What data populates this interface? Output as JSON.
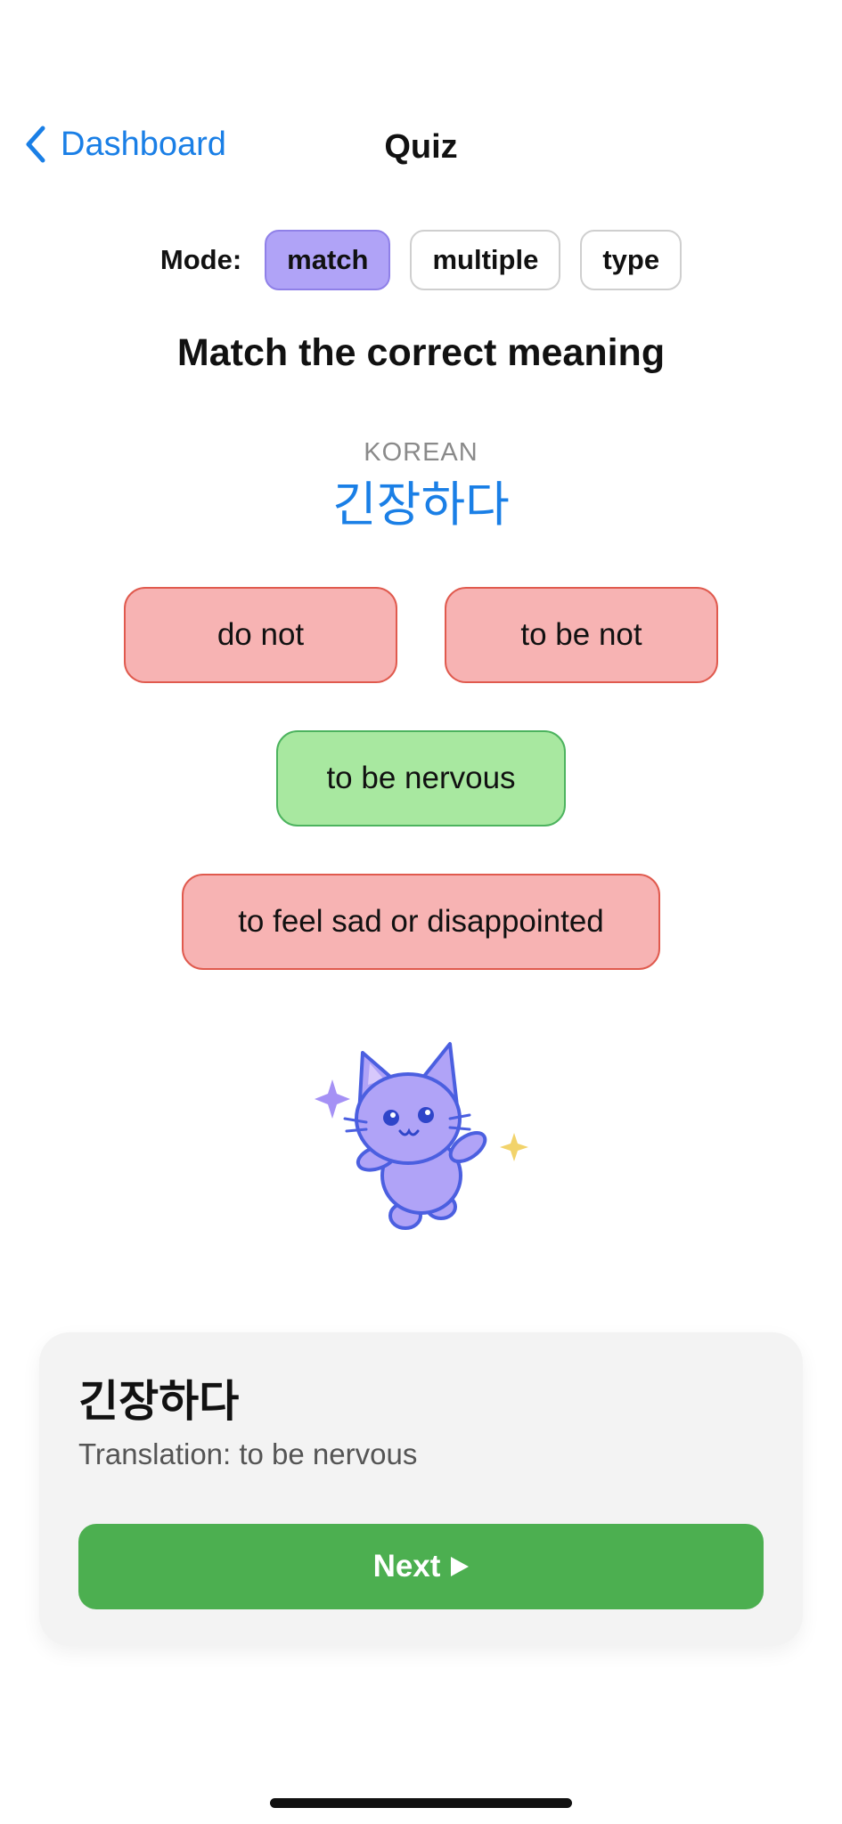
{
  "nav": {
    "back_label": "Dashboard",
    "title": "Quiz"
  },
  "mode": {
    "label": "Mode:",
    "options": [
      "match",
      "multiple",
      "type"
    ],
    "selected": "match"
  },
  "quiz": {
    "instruction": "Match the correct meaning",
    "language_label": "KOREAN",
    "word": "긴장하다",
    "options": [
      {
        "text": "do not",
        "state": "wrong"
      },
      {
        "text": "to be not",
        "state": "wrong"
      },
      {
        "text": "to be nervous",
        "state": "correct"
      },
      {
        "text": "to feel sad or disappointed",
        "state": "wrong"
      }
    ]
  },
  "result": {
    "word": "긴장하다",
    "translation": "Translation: to be nervous",
    "next_label": "Next"
  },
  "colors": {
    "accent_blue": "#1a7fe6",
    "mode_active": "#b0a3f7",
    "wrong_bg": "#f7b3b3",
    "correct_bg": "#a8e8a0",
    "next_button": "#4caf50",
    "mascot": "#b0a3f7"
  },
  "icons": {
    "back": "chevron-left-icon",
    "next": "play-triangle-icon",
    "mascot": "cat-mascot"
  }
}
